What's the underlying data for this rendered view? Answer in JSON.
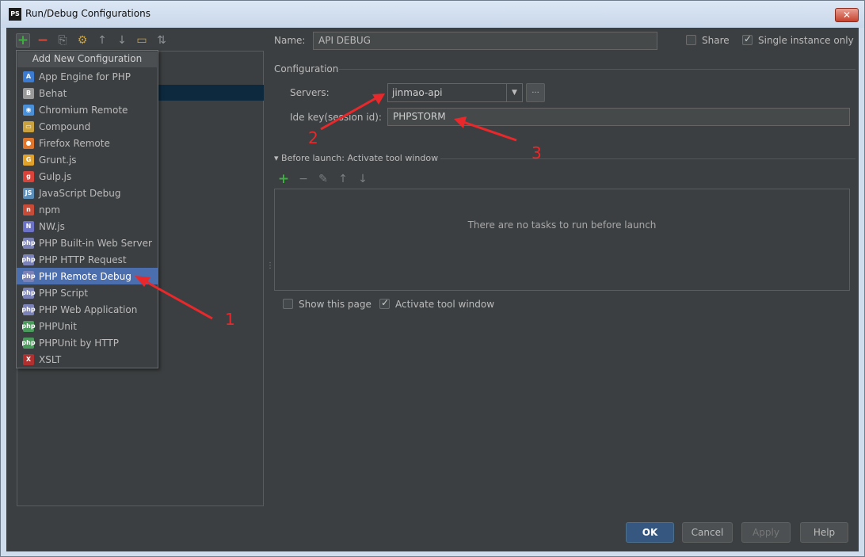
{
  "window": {
    "title": "Run/Debug Configurations",
    "app_icon": "PS",
    "close_glyph": "✕"
  },
  "toolbar": {
    "add": "+",
    "remove": "−",
    "copy": "⎘",
    "edit_defaults": "⚙",
    "move_up": "↑",
    "move_down": "↓",
    "folder": "▭",
    "sort": "⇅"
  },
  "popup": {
    "header": "Add New Configuration",
    "items": [
      {
        "label": "App Engine for PHP",
        "icon": "app-engine-icon",
        "glyph": "A",
        "color": "#3b7bd1"
      },
      {
        "label": "Behat",
        "icon": "behat-icon",
        "glyph": "B",
        "color": "#9a9a9a"
      },
      {
        "label": "Chromium Remote",
        "icon": "chromium-icon",
        "glyph": "◉",
        "color": "#4a90d9"
      },
      {
        "label": "Compound",
        "icon": "compound-icon",
        "glyph": "▭",
        "color": "#c9a23f"
      },
      {
        "label": "Firefox Remote",
        "icon": "firefox-icon",
        "glyph": "●",
        "color": "#e0762b"
      },
      {
        "label": "Grunt.js",
        "icon": "grunt-icon",
        "glyph": "G",
        "color": "#e0a22b"
      },
      {
        "label": "Gulp.js",
        "icon": "gulp-icon",
        "glyph": "g",
        "color": "#d9433a"
      },
      {
        "label": "JavaScript Debug",
        "icon": "js-debug-icon",
        "glyph": "JS",
        "color": "#5b8fb9"
      },
      {
        "label": "npm",
        "icon": "npm-icon",
        "glyph": "n",
        "color": "#c84b38"
      },
      {
        "label": "NW.js",
        "icon": "nwjs-icon",
        "glyph": "N",
        "color": "#6b72c8"
      },
      {
        "label": "PHP Built-in Web Server",
        "icon": "php-icon",
        "glyph": "php",
        "color": "#7b82b8"
      },
      {
        "label": "PHP HTTP Request",
        "icon": "php-icon",
        "glyph": "php",
        "color": "#7b82b8"
      },
      {
        "label": "PHP Remote Debug",
        "icon": "php-icon",
        "glyph": "php",
        "color": "#7b82b8"
      },
      {
        "label": "PHP Script",
        "icon": "php-icon",
        "glyph": "php",
        "color": "#7b82b8"
      },
      {
        "label": "PHP Web Application",
        "icon": "php-icon",
        "glyph": "php",
        "color": "#7b82b8"
      },
      {
        "label": "PHPUnit",
        "icon": "phpunit-icon",
        "glyph": "php",
        "color": "#4a9a5b"
      },
      {
        "label": "PHPUnit by HTTP",
        "icon": "phpunit-icon",
        "glyph": "php",
        "color": "#4a9a5b"
      },
      {
        "label": "XSLT",
        "icon": "xslt-icon",
        "glyph": "X",
        "color": "#b03030"
      }
    ],
    "selected_index": 12
  },
  "form": {
    "name_label": "Name:",
    "name_value": "API DEBUG",
    "share_label": "Share",
    "share_checked": false,
    "single_instance_label": "Single instance only",
    "single_instance_checked": true,
    "configuration_label": "Configuration",
    "servers_label": "Servers:",
    "servers_value": "jinmao-api",
    "combo_arrow": "▼",
    "more_button": "...",
    "ide_key_label": "Ide key(session id):",
    "ide_key_value": "PHPSTORM"
  },
  "before_launch": {
    "title": "Before launch: Activate tool window",
    "toggle": "▾",
    "toolbar": {
      "add": "+",
      "remove": "−",
      "edit": "✎",
      "up": "↑",
      "down": "↓"
    },
    "empty_text": "There are no tasks to run before launch",
    "show_page_label": "Show this page",
    "show_page_checked": false,
    "activate_label": "Activate tool window",
    "activate_checked": true
  },
  "buttons": {
    "ok": "OK",
    "cancel": "Cancel",
    "apply": "Apply",
    "help": "Help"
  },
  "annotations": {
    "one": "1",
    "two": "2",
    "three": "3",
    "color": "#e8282a"
  }
}
